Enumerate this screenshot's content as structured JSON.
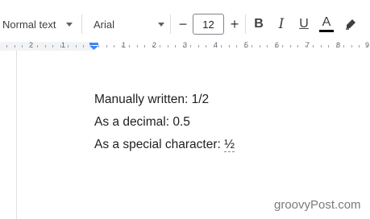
{
  "toolbar": {
    "style_select": "Normal text",
    "font_select": "Arial",
    "font_size_decrease": "−",
    "font_size": "12",
    "font_size_increase": "+",
    "bold": "B",
    "italic": "I",
    "underline": "U",
    "text_color": "A",
    "text_color_value": "#000000",
    "highlight_icon": "highlighter-icon"
  },
  "ruler": {
    "labels": [
      "2",
      "1",
      "1",
      "2",
      "3",
      "4",
      "5",
      "6",
      "7",
      "8",
      "9"
    ]
  },
  "document": {
    "lines": [
      "Manually written: 1/2",
      "As a decimal: 0.5",
      "As a special character: "
    ],
    "special_character": "½"
  },
  "watermark": "groovyPost.com"
}
